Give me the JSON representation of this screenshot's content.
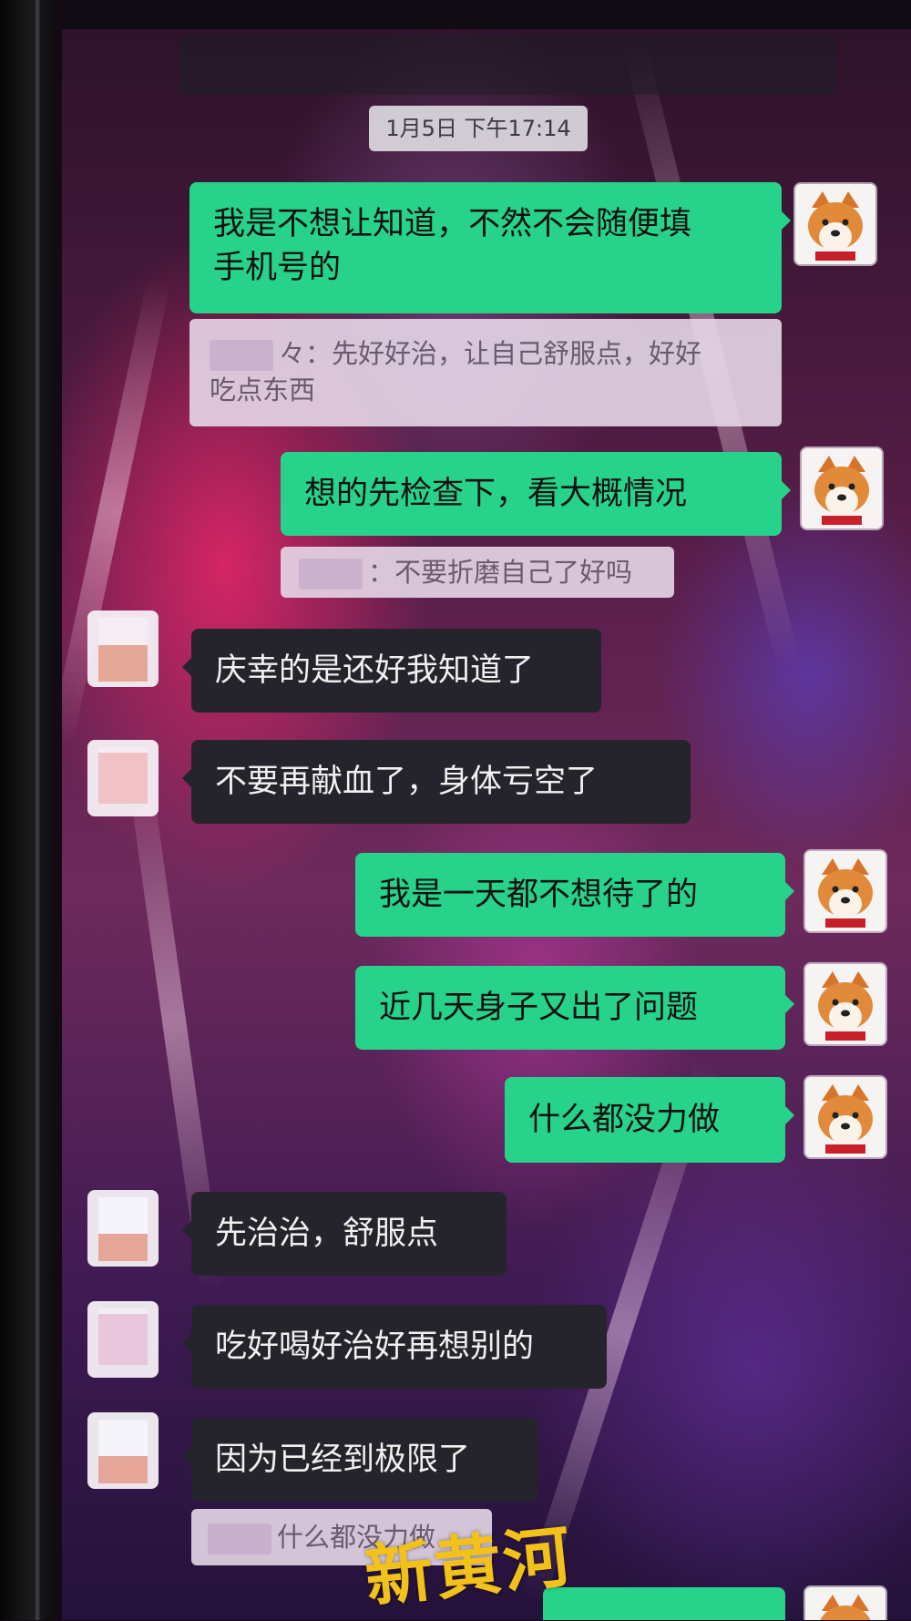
{
  "chat": {
    "timestamp": "1月5日 下午17:14",
    "messages": [
      {
        "side": "me",
        "type": "text",
        "lines": [
          "我是不想让知道，不然不会随便填",
          "手机号的"
        ]
      },
      {
        "side": "me",
        "type": "quote",
        "lines": [
          "々：先好好治，让自己舒服点，好好",
          "吃点东西"
        ]
      },
      {
        "side": "me",
        "type": "text",
        "text": "想的先检查下，看大概情况"
      },
      {
        "side": "me",
        "type": "quote",
        "text": "：不要折磨自己了好吗"
      },
      {
        "side": "other",
        "type": "text",
        "text": "庆幸的是还好我知道了"
      },
      {
        "side": "other",
        "type": "text",
        "text": "不要再献血了，身体亏空了"
      },
      {
        "side": "me",
        "type": "text",
        "text": "我是一天都不想待了的"
      },
      {
        "side": "me",
        "type": "text",
        "text": "近几天身子又出了问题"
      },
      {
        "side": "me",
        "type": "text",
        "text": "什么都没力做"
      },
      {
        "side": "other",
        "type": "text",
        "text": "先治治，舒服点"
      },
      {
        "side": "other",
        "type": "text",
        "text": "吃好喝好治好再想别的"
      },
      {
        "side": "other",
        "type": "text",
        "text": "因为已经到极限了"
      },
      {
        "side": "other",
        "type": "quote",
        "text": "什么都没力做"
      }
    ]
  },
  "colors": {
    "my_bubble": "#27d38a",
    "other_bubble": "#25242c",
    "quote_bubble": "#e6d7e8"
  },
  "icons": {
    "my_avatar": "shiba-dog-avatar",
    "other_avatar": "pixelated-avatar"
  },
  "watermark": "新黄河"
}
